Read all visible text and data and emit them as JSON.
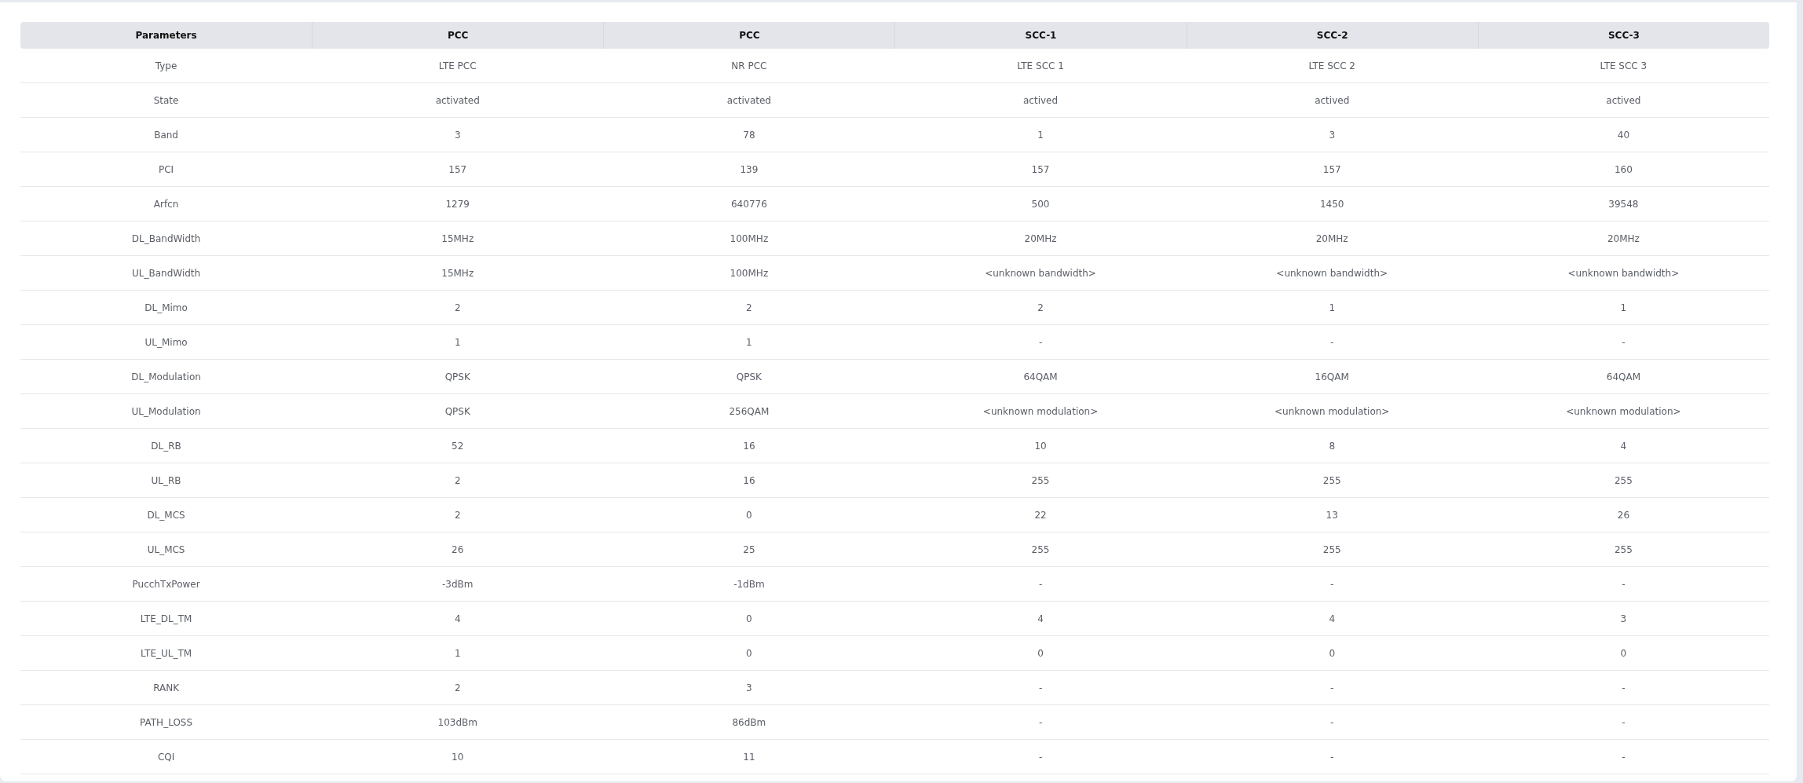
{
  "table": {
    "columns": [
      "Parameters",
      "PCC",
      "PCC",
      "SCC-1",
      "SCC-2",
      "SCC-3"
    ],
    "rows": [
      [
        "Type",
        "LTE PCC",
        "NR PCC",
        "LTE SCC 1",
        "LTE SCC 2",
        "LTE SCC 3"
      ],
      [
        "State",
        "activated",
        "activated",
        "actived",
        "actived",
        "actived"
      ],
      [
        "Band",
        "3",
        "78",
        "1",
        "3",
        "40"
      ],
      [
        "PCI",
        "157",
        "139",
        "157",
        "157",
        "160"
      ],
      [
        "Arfcn",
        "1279",
        "640776",
        "500",
        "1450",
        "39548"
      ],
      [
        "DL_BandWidth",
        "15MHz",
        "100MHz",
        "20MHz",
        "20MHz",
        "20MHz"
      ],
      [
        "UL_BandWidth",
        "15MHz",
        "100MHz",
        "<unknown bandwidth>",
        "<unknown bandwidth>",
        "<unknown bandwidth>"
      ],
      [
        "DL_Mimo",
        "2",
        "2",
        "2",
        "1",
        "1"
      ],
      [
        "UL_Mimo",
        "1",
        "1",
        "-",
        "-",
        "-"
      ],
      [
        "DL_Modulation",
        "QPSK",
        "QPSK",
        "64QAM",
        "16QAM",
        "64QAM"
      ],
      [
        "UL_Modulation",
        "QPSK",
        "256QAM",
        "<unknown modulation>",
        "<unknown modulation>",
        "<unknown modulation>"
      ],
      [
        "DL_RB",
        "52",
        "16",
        "10",
        "8",
        "4"
      ],
      [
        "UL_RB",
        "2",
        "16",
        "255",
        "255",
        "255"
      ],
      [
        "DL_MCS",
        "2",
        "0",
        "22",
        "13",
        "26"
      ],
      [
        "UL_MCS",
        "26",
        "25",
        "255",
        "255",
        "255"
      ],
      [
        "PucchTxPower",
        "-3dBm",
        "-1dBm",
        "-",
        "-",
        "-"
      ],
      [
        "LTE_DL_TM",
        "4",
        "0",
        "4",
        "4",
        "3"
      ],
      [
        "LTE_UL_TM",
        "1",
        "0",
        "0",
        "0",
        "0"
      ],
      [
        "RANK",
        "2",
        "3",
        "-",
        "-",
        "-"
      ],
      [
        "PATH_LOSS",
        "103dBm",
        "86dBm",
        "-",
        "-",
        "-"
      ],
      [
        "CQI",
        "10",
        "11",
        "-",
        "-",
        "-"
      ]
    ]
  }
}
